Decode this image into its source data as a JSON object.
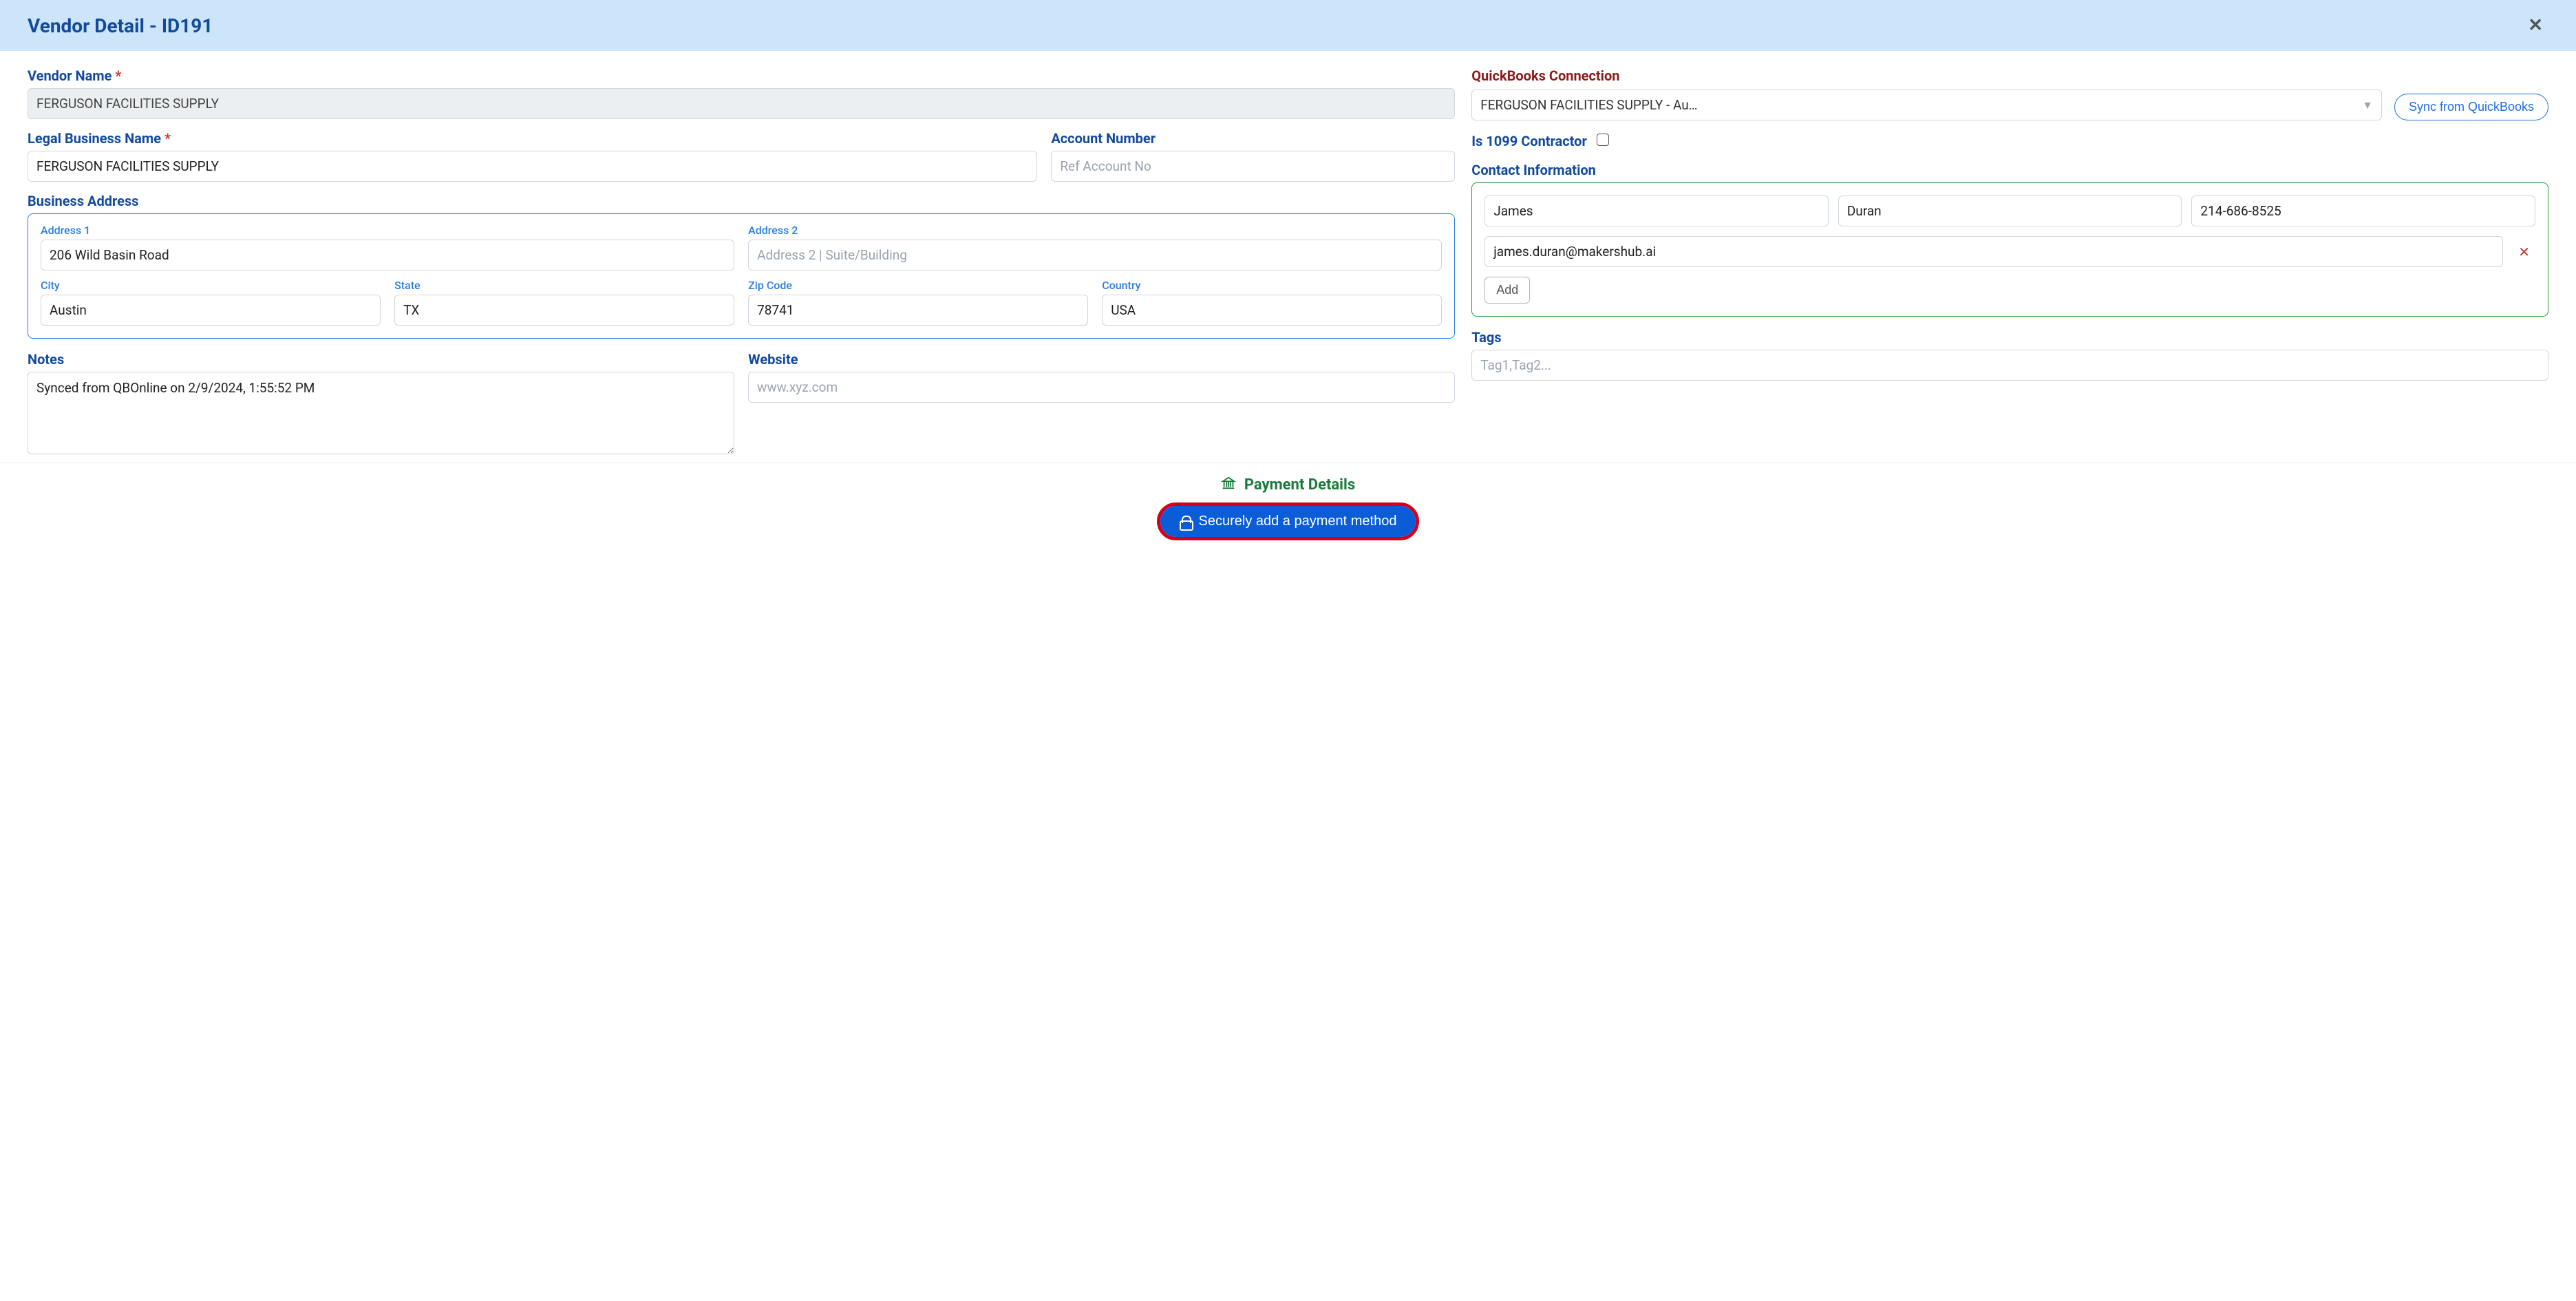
{
  "header": {
    "title": "Vendor Detail - ID191"
  },
  "vendor": {
    "name_label": "Vendor Name",
    "name_value": "FERGUSON FACILITIES SUPPLY",
    "legal_label": "Legal Business Name",
    "legal_value": "FERGUSON FACILITIES SUPPLY",
    "account_label": "Account Number",
    "account_placeholder": "Ref Account No"
  },
  "address": {
    "label": "Business Address",
    "addr1_label": "Address 1",
    "addr1_value": "206 Wild Basin Road",
    "addr2_label": "Address 2",
    "addr2_placeholder": "Address 2 | Suite/Building",
    "city_label": "City",
    "city_value": "Austin",
    "state_label": "State",
    "state_value": "TX",
    "zip_label": "Zip Code",
    "zip_value": "78741",
    "country_label": "Country",
    "country_value": "USA"
  },
  "notes": {
    "label": "Notes",
    "value": "Synced from QBOnline on 2/9/2024, 1:55:52 PM"
  },
  "website": {
    "label": "Website",
    "placeholder": "www.xyz.com"
  },
  "quickbooks": {
    "label": "QuickBooks Connection",
    "selected": "FERGUSON FACILITIES SUPPLY - Au…",
    "sync_button": "Sync from QuickBooks"
  },
  "contractor": {
    "label": "Is 1099 Contractor",
    "checked": false
  },
  "contact": {
    "label": "Contact Information",
    "first": "James",
    "last": "Duran",
    "phone": "214-686-8525",
    "email": "james.duran@makershub.ai",
    "add_button": "Add"
  },
  "tags": {
    "label": "Tags",
    "placeholder": "Tag1,Tag2..."
  },
  "payment": {
    "title": "Payment Details",
    "button": "Securely add a payment method"
  }
}
